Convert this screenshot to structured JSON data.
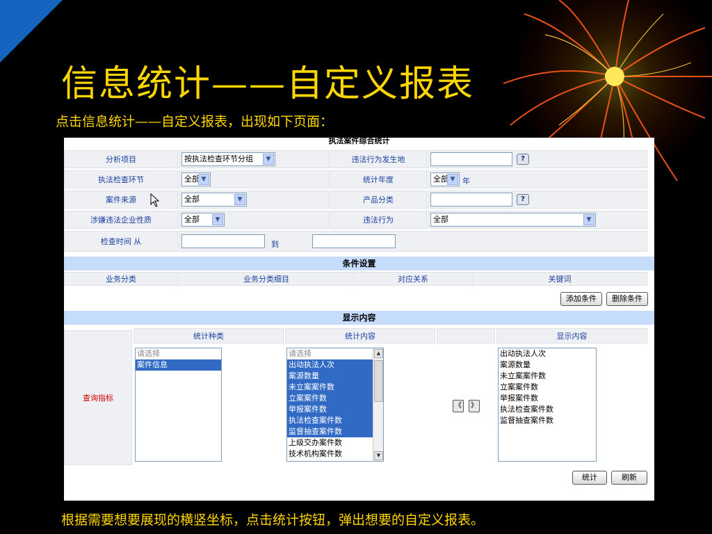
{
  "slide": {
    "title": "信息统计——自定义报表",
    "subtitle": "点击信息统计——自定义报表，出现如下页面：",
    "footer": "根据需要想要展现的横竖坐标，点击统计按钮，弹出想要的自定义报表。"
  },
  "colors": {
    "title": "#ffd700",
    "band": "#c6dcfb",
    "label": "#1a3fa0",
    "selected": "#316ac5",
    "accent_red": "#cc0000"
  },
  "form": {
    "title": "执法案件综合统计",
    "rows": [
      {
        "label": "分析项目",
        "value": "按执法检查环节分组",
        "right_label": "违法行为发生地",
        "right_value": ""
      },
      {
        "label": "执法检查环节",
        "value": "全部",
        "right_label": "统计年度",
        "right_value": "全部",
        "right_unit": "年"
      },
      {
        "label": "案件来源",
        "value": "全部",
        "right_label": "产品分类",
        "right_value": ""
      },
      {
        "label": "涉嫌违法企业性质",
        "value": "全部",
        "right_label": "违法行为",
        "right_value": "全部"
      }
    ],
    "time": {
      "label": "检查时间 从",
      "to": "到",
      "from_value": "",
      "to_value": ""
    },
    "help_icon": "question-icon",
    "dropdown_icon": "chevron-down-icon"
  },
  "conditions": {
    "section_title": "条件设置",
    "headers": [
      "业务分类",
      "业务分类细目",
      "对应关系",
      "关键词"
    ],
    "add_button": "添加条件",
    "delete_button": "删除条件"
  },
  "display": {
    "section_title": "显示内容",
    "headers": [
      "统计种类",
      "统计内容",
      "",
      "显示内容"
    ],
    "row_label": "查询指标",
    "category_list": [
      {
        "text": "请选择",
        "placeholder": true,
        "selected": false
      },
      {
        "text": "案件信息",
        "placeholder": false,
        "selected": true
      }
    ],
    "content_list": [
      {
        "text": "请选择",
        "placeholder": true,
        "selected": false
      },
      {
        "text": "出动执法人次",
        "placeholder": false,
        "selected": true
      },
      {
        "text": "案源数量",
        "placeholder": false,
        "selected": true
      },
      {
        "text": "未立案案件数",
        "placeholder": false,
        "selected": true
      },
      {
        "text": "立案案件数",
        "placeholder": false,
        "selected": true
      },
      {
        "text": "举报案件数",
        "placeholder": false,
        "selected": true
      },
      {
        "text": "执法检查案件数",
        "placeholder": false,
        "selected": true
      },
      {
        "text": "监督抽查案件数",
        "placeholder": false,
        "selected": true
      },
      {
        "text": "上级交办案件数",
        "placeholder": false,
        "selected": false
      },
      {
        "text": "技术机构案件数",
        "placeholder": false,
        "selected": false
      }
    ],
    "shown_list": [
      "出动执法人次",
      "案源数量",
      "未立案案件数",
      "立案案件数",
      "举报案件数",
      "执法检查案件数",
      "监督抽查案件数"
    ],
    "move_left": "《",
    "move_right": "》",
    "stat_button": "统计",
    "refresh_button": "刷新"
  }
}
